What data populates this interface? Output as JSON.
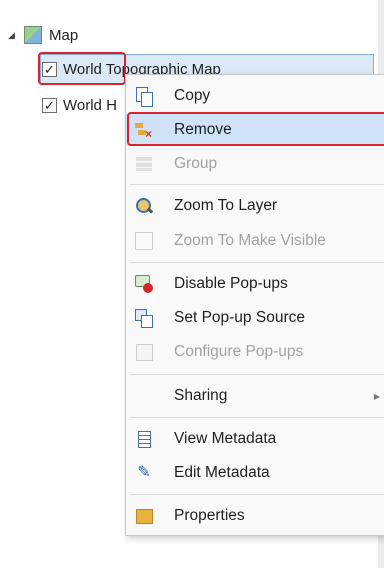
{
  "tree": {
    "root_label": "Map",
    "layers": [
      {
        "label": "World Topographic Map",
        "checked": "✓"
      },
      {
        "label": "World H",
        "checked": "✓"
      }
    ]
  },
  "menu": {
    "items": [
      {
        "label": "Copy",
        "icon": "copy-icon",
        "enabled": true
      },
      {
        "label": "Remove",
        "icon": "remove-layer-icon",
        "enabled": true,
        "highlighted": true
      },
      {
        "label": "Group",
        "icon": "group-icon",
        "enabled": false
      },
      {
        "label": "Zoom To Layer",
        "icon": "zoom-to-layer-icon",
        "enabled": true
      },
      {
        "label": "Zoom To Make Visible",
        "icon": "zoom-to-make-visible-icon",
        "enabled": false
      },
      {
        "label": "Disable Pop-ups",
        "icon": "disable-popups-icon",
        "enabled": true
      },
      {
        "label": "Set Pop-up Source",
        "icon": "set-popup-source-icon",
        "enabled": true
      },
      {
        "label": "Configure Pop-ups",
        "icon": "configure-popups-icon",
        "enabled": false
      },
      {
        "label": "Sharing",
        "icon": "",
        "enabled": true,
        "submenu": true
      },
      {
        "label": "View Metadata",
        "icon": "view-metadata-icon",
        "enabled": true
      },
      {
        "label": "Edit Metadata",
        "icon": "edit-metadata-icon",
        "enabled": true
      },
      {
        "label": "Properties",
        "icon": "properties-icon",
        "enabled": true
      }
    ]
  },
  "colors": {
    "highlight": "#cfe2f8",
    "annotation_red": "#d9262e"
  }
}
